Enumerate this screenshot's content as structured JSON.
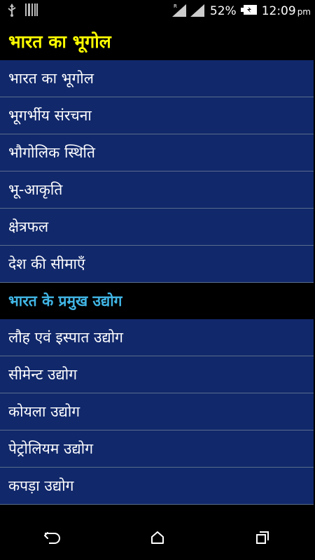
{
  "status_bar": {
    "battery_percent": "52%",
    "time": "12:09",
    "ampm": "pm",
    "icons": [
      "usb-icon",
      "signal-icon",
      "battery-icon"
    ]
  },
  "sections": [
    {
      "title": "भारत का भूगोल",
      "color": "#ffff00",
      "items": [
        "भारत का भूगोल",
        "भूगर्भीय संरचना",
        "भौगोलिक स्थिति",
        "भू-आकृति",
        "क्षेत्रफल",
        "देश की सीमाएँ"
      ]
    },
    {
      "title": "भारत के प्रमुख उद्योग",
      "color": "#41b6e6",
      "items": [
        "लौह एवं इस्पात उद्योग",
        "सीमेन्ट उद्योग",
        "कोयला उद्योग",
        "पेट्रोलियम उद्योग",
        "कपड़ा उद्योग"
      ]
    }
  ],
  "colors": {
    "item_background": "#11286b",
    "header_background": "#000000"
  },
  "nav_bar": {
    "icons": [
      "back-icon",
      "home-icon",
      "recents-icon"
    ]
  }
}
